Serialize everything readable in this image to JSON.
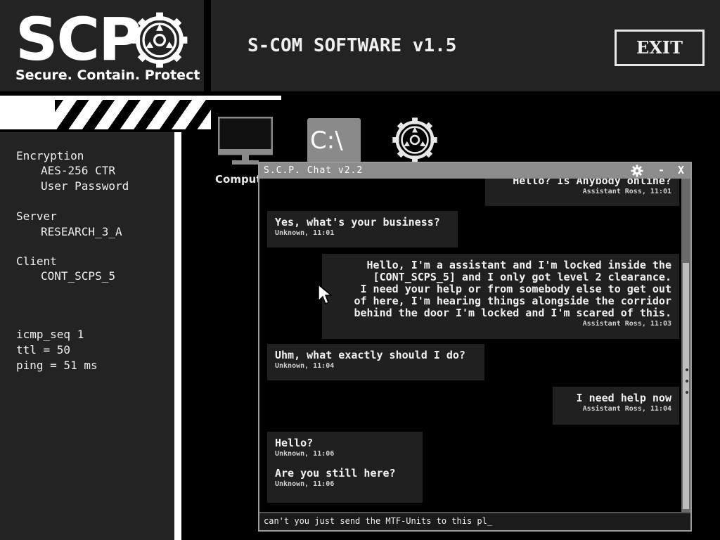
{
  "header": {
    "logo_text": "SCP",
    "logo_tagline": "Secure. Contain. Protect",
    "title": "S-COM SOFTWARE v1.5",
    "exit_label": "EXIT"
  },
  "info": {
    "encryption_label": "Encryption",
    "encryption_values": [
      "AES-256 CTR",
      "User Password"
    ],
    "server_label": "Server",
    "server_value": "RESEARCH_3_A",
    "client_label": "Client",
    "client_value": "CONT_SCPS_5",
    "stats": [
      "icmp_seq 1",
      "ttl = 50",
      "ping = 51 ms"
    ]
  },
  "desktop": {
    "icons": [
      {
        "name": "computer-icon",
        "label": "Comput"
      },
      {
        "name": "command-prompt-icon",
        "label": "C:\\"
      },
      {
        "name": "scp-icon",
        "label": ""
      }
    ]
  },
  "chat": {
    "title": "S.C.P. Chat v2.2",
    "minimize": "-",
    "close": "X",
    "messages": [
      {
        "side": "right",
        "text": "Hello? Is Anybody online?",
        "meta": "Assistant Ross, 11:01"
      },
      {
        "side": "left",
        "text": "Yes, what's your business?",
        "meta": "Unknown, 11:01"
      },
      {
        "side": "right",
        "text": "Hello, I'm a assistant and I'm locked inside the\n[CONT_SCPS_5] and I only got level 2 clearance.\nI need your help or from somebody else to get out\nof here, I'm hearing things alongside the corridor\nbehind the door I'm locked and I'm scared of this.",
        "meta": "Assistant Ross, 11:03"
      },
      {
        "side": "left",
        "text": "Uhm, what exactly should I do?",
        "meta": "Unknown, 11:04"
      },
      {
        "side": "right",
        "text": "I need help now",
        "meta": "Assistant Ross, 11:04"
      },
      {
        "side": "left",
        "text": "Hello?",
        "meta": "Unknown, 11:06"
      },
      {
        "side": "left",
        "text": "Are you still here?",
        "meta": "Unknown, 11:06"
      }
    ],
    "input_value": "can't you just send the MTF-Units to this pl_"
  }
}
